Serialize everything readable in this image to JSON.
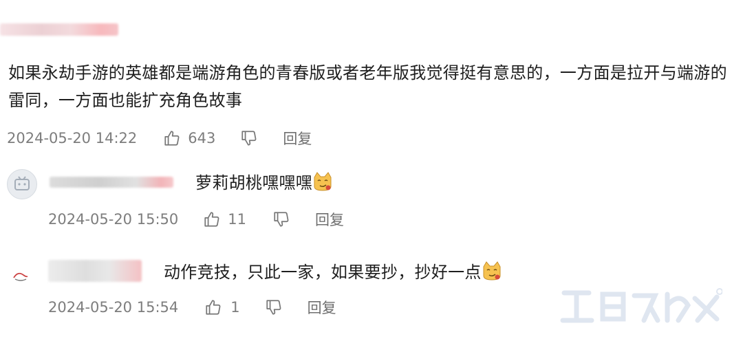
{
  "comment": {
    "text": "如果永劫手游的英雄都是端游角色的青春版或者老年版我觉得挺有意思的，一方面是拉开与端游的雷同，一方面也能扩充角色故事",
    "date": "2024-05-20 14:22",
    "likes": "643",
    "reply_label": "回复"
  },
  "replies": [
    {
      "text": "萝莉胡桃嘿嘿嘿",
      "emoji": "cat-smirk-emoji",
      "date": "2024-05-20 15:50",
      "likes": "11",
      "reply_label": "回复"
    },
    {
      "text": "动作竞技，只此一家，如果要抄，抄好一点",
      "emoji": "cat-smirk-emoji",
      "date": "2024-05-20 15:54",
      "likes": "1",
      "reply_label": "回复"
    }
  ],
  "icons": {
    "like": "thumbs-up-icon",
    "dislike": "thumbs-down-icon"
  }
}
